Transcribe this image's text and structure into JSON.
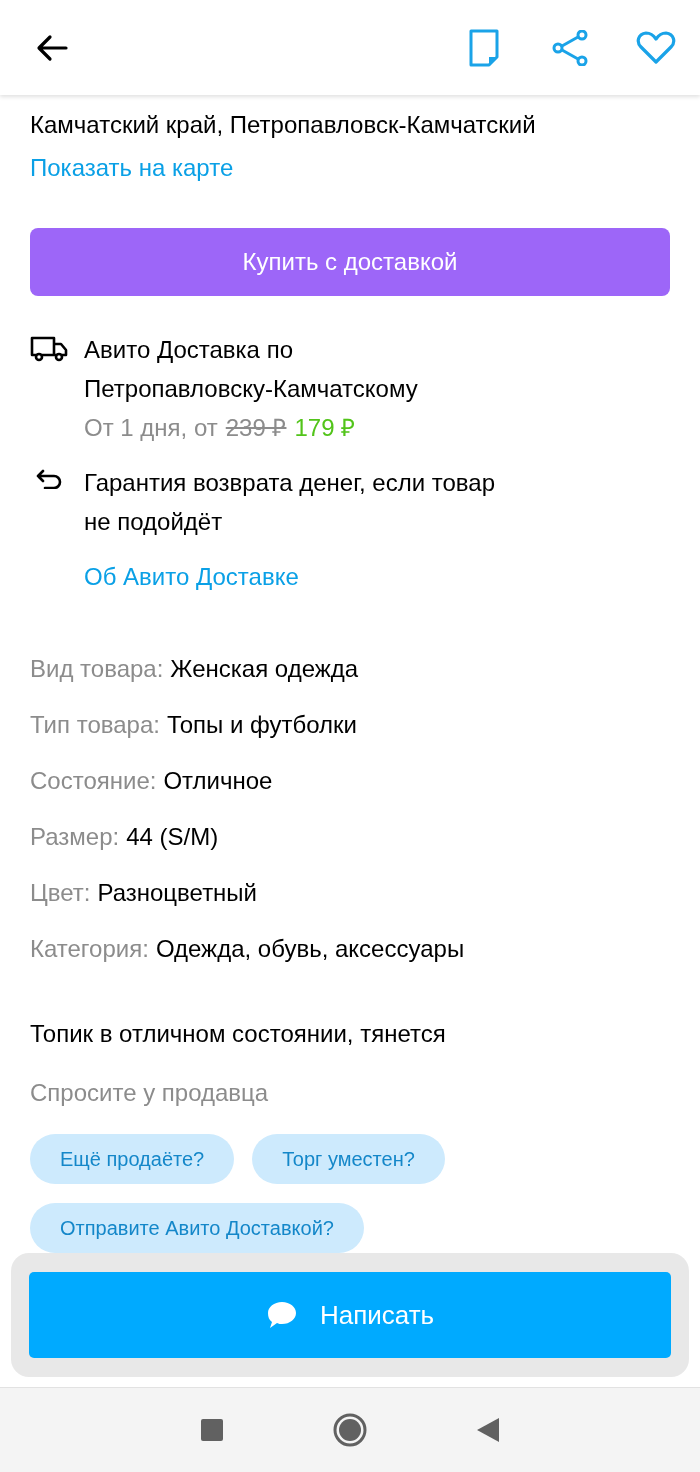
{
  "location": {
    "address": "Камчатский край, Петропавловск-Камчатский",
    "map_link": "Показать на карте"
  },
  "buy_button": "Купить с доставкой",
  "delivery": {
    "title": "Авито Доставка по\nПетропавловску-Камчатскому",
    "terms": "От 1 дня, от",
    "old_price": "239 ₽",
    "price": "179 ₽"
  },
  "guarantee": "Гарантия возврата денег, если товар\nне подойдёт",
  "about_link": "Об Авито Доставке",
  "params": [
    {
      "label": "Вид товара:",
      "value": "Женская одежда"
    },
    {
      "label": "Тип товара:",
      "value": "Топы и футболки"
    },
    {
      "label": "Состояние:",
      "value": "Отличное"
    },
    {
      "label": "Размер:",
      "value": "44 (S/M)"
    },
    {
      "label": "Цвет:",
      "value": "Разноцветный"
    },
    {
      "label": "Категория:",
      "value": "Одежда, обувь, аксессуары"
    }
  ],
  "description": "Топик в отличном состоянии, тянется",
  "ask_seller": {
    "title": "Спросите у продавца",
    "chips": [
      "Ещё продаёте?",
      "Торг уместен?",
      "Отправите Авито Доставкой?"
    ]
  },
  "write_button": "Написать"
}
